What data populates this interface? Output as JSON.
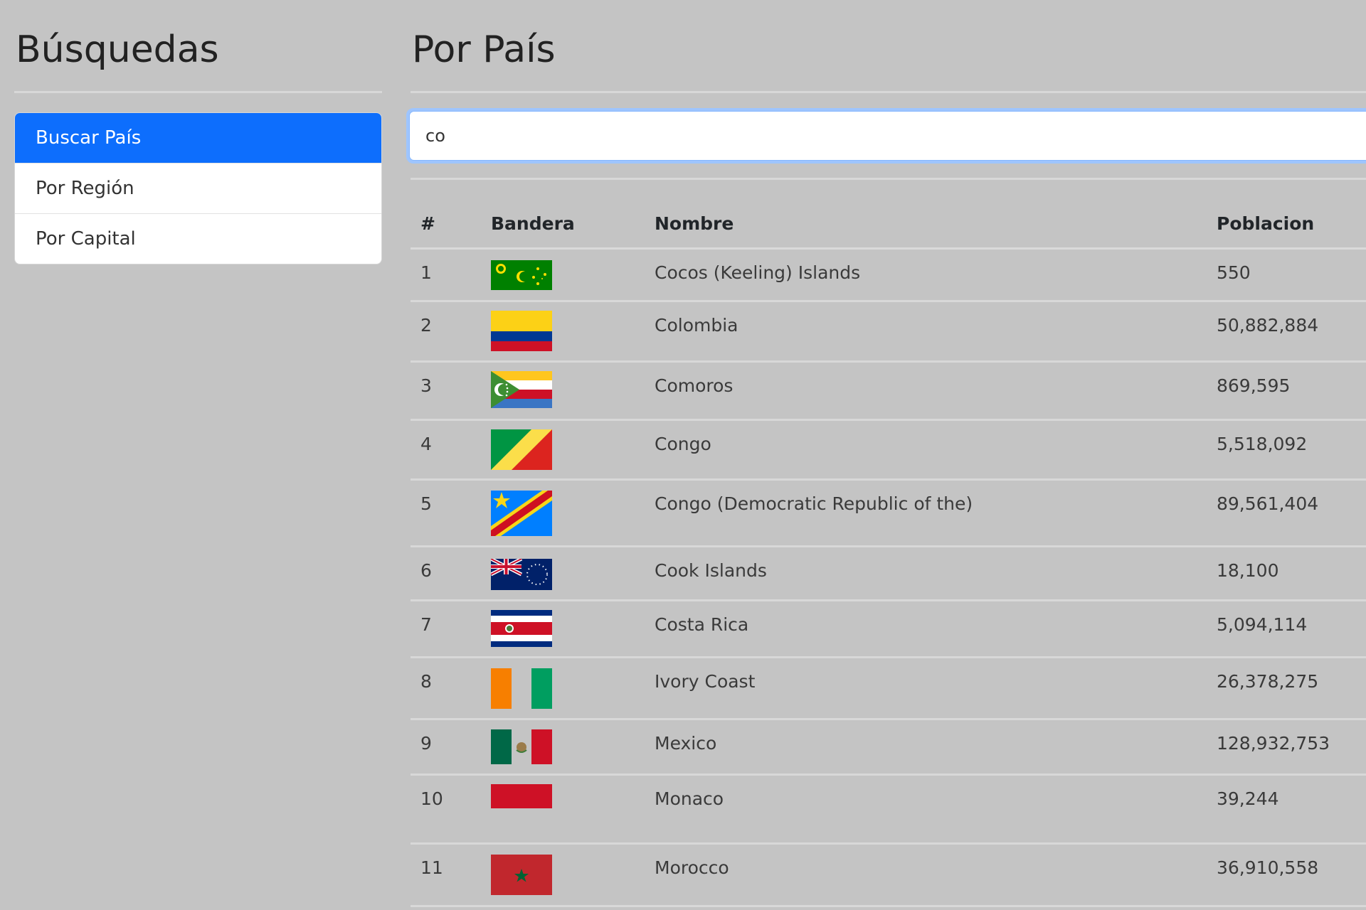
{
  "sidebar": {
    "title": "Búsquedas",
    "items": [
      {
        "label": "Buscar País",
        "active": true
      },
      {
        "label": "Por Región",
        "active": false
      },
      {
        "label": "Por Capital",
        "active": false
      }
    ]
  },
  "main": {
    "title": "Por País",
    "search": {
      "value": "co"
    },
    "table": {
      "headers": [
        "#",
        "Bandera",
        "Nombre",
        "Poblacion"
      ],
      "rows": [
        {
          "num": "1",
          "flag_icon": "cocos-keeling-islands-flag",
          "name": "Cocos (Keeling) Islands",
          "population": "550"
        },
        {
          "num": "2",
          "flag_icon": "colombia-flag",
          "name": "Colombia",
          "population": "50,882,884"
        },
        {
          "num": "3",
          "flag_icon": "comoros-flag",
          "name": "Comoros",
          "population": "869,595"
        },
        {
          "num": "4",
          "flag_icon": "congo-flag",
          "name": "Congo",
          "population": "5,518,092"
        },
        {
          "num": "5",
          "flag_icon": "dr-congo-flag",
          "name": "Congo (Democratic Republic of the)",
          "population": "89,561,404"
        },
        {
          "num": "6",
          "flag_icon": "cook-islands-flag",
          "name": "Cook Islands",
          "population": "18,100"
        },
        {
          "num": "7",
          "flag_icon": "costa-rica-flag",
          "name": "Costa Rica",
          "population": "5,094,114"
        },
        {
          "num": "8",
          "flag_icon": "ivory-coast-flag",
          "name": "Ivory Coast",
          "population": "26,378,275"
        },
        {
          "num": "9",
          "flag_icon": "mexico-flag",
          "name": "Mexico",
          "population": "128,932,753"
        },
        {
          "num": "10",
          "flag_icon": "monaco-flag",
          "name": "Monaco",
          "population": "39,244"
        },
        {
          "num": "11",
          "flag_icon": "morocco-flag",
          "name": "Morocco",
          "population": "36,910,558"
        }
      ]
    }
  },
  "colors": {
    "background": "#c4c4c4",
    "active": "#0d6efd",
    "focus_ring": "#9ec5fe"
  }
}
